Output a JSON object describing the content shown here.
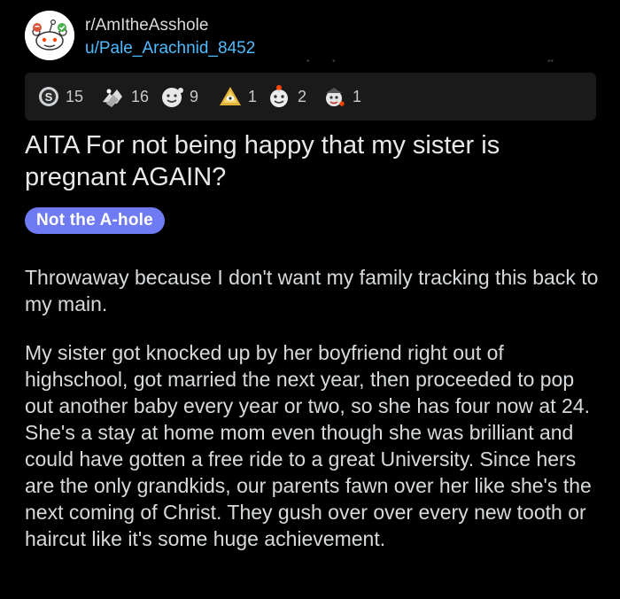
{
  "post": {
    "subreddit": "r/AmItheAsshole",
    "author": "u/Pale_Arachnid_8452",
    "title": "AITA For not being happy that my sister is pregnant AGAIN?",
    "flair": "Not the A-hole",
    "flair_color": "#6e7bf2",
    "paragraphs": [
      "Throwaway because I don't want my family tracking this back to my main.",
      "My sister got knocked up by her boyfriend right out of highschool, got married the next year, then proceeded to pop out another baby every year or two, so she has four now at 24. She's a stay at home mom even though she was brilliant and could have gotten a free ride to a great University. Since hers are the only grandkids, our parents fawn over her like she's the next coming of Christ. They gush over over every new tooth or haircut like it's some huge achievement."
    ]
  },
  "awards": [
    {
      "icon": "silver-award-icon",
      "count": "15"
    },
    {
      "icon": "helpful-award-icon",
      "count": "16"
    },
    {
      "icon": "wholesome-award-icon",
      "count": "9"
    },
    {
      "icon": "all-seeing-upvote-icon",
      "count": "1"
    },
    {
      "icon": "gold-award-icon",
      "count": "2"
    },
    {
      "icon": "rocket-like-award-icon",
      "count": "1"
    }
  ],
  "colors": {
    "background": "#000000",
    "award_bar": "#1a1a1b",
    "link": "#4fbcff",
    "text": "#d7dadc"
  }
}
